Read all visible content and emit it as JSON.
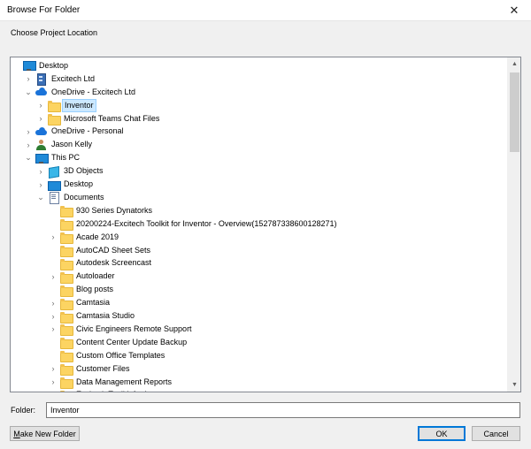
{
  "window": {
    "title": "Browse For Folder",
    "close_glyph": "✕"
  },
  "prompt": "Choose Project Location",
  "tree": {
    "items": [
      {
        "label": "Desktop",
        "level": 0,
        "chevron": "",
        "icon": "monitor-icon",
        "selected": false
      },
      {
        "label": "Excitech Ltd",
        "level": 1,
        "chevron": "›",
        "icon": "building-icon",
        "selected": false
      },
      {
        "label": "OneDrive - Excitech Ltd",
        "level": 1,
        "chevron": "⌄",
        "icon": "cloud-icon",
        "selected": false
      },
      {
        "label": "Inventor",
        "level": 2,
        "chevron": "›",
        "icon": "folder-icon",
        "selected": true
      },
      {
        "label": "Microsoft Teams Chat Files",
        "level": 2,
        "chevron": "›",
        "icon": "folder-icon",
        "selected": false
      },
      {
        "label": "OneDrive - Personal",
        "level": 1,
        "chevron": "›",
        "icon": "cloud-icon",
        "selected": false
      },
      {
        "label": "Jason Kelly",
        "level": 1,
        "chevron": "›",
        "icon": "person-icon",
        "selected": false
      },
      {
        "label": "This PC",
        "level": 1,
        "chevron": "⌄",
        "icon": "monitor-icon",
        "selected": false
      },
      {
        "label": "3D Objects",
        "level": 2,
        "chevron": "›",
        "icon": "cube-icon",
        "selected": false
      },
      {
        "label": "Desktop",
        "level": 2,
        "chevron": "›",
        "icon": "desktop-icon",
        "selected": false
      },
      {
        "label": "Documents",
        "level": 2,
        "chevron": "⌄",
        "icon": "document-icon",
        "selected": false
      },
      {
        "label": "930 Series Dynatorks",
        "level": 3,
        "chevron": "",
        "icon": "folder-icon",
        "selected": false
      },
      {
        "label": "20200224-Excitech Toolkit for Inventor - Overview(152787338600128271)",
        "level": 3,
        "chevron": "",
        "icon": "folder-icon",
        "selected": false
      },
      {
        "label": "Acade 2019",
        "level": 3,
        "chevron": "›",
        "icon": "folder-icon",
        "selected": false
      },
      {
        "label": "AutoCAD Sheet Sets",
        "level": 3,
        "chevron": "",
        "icon": "folder-icon",
        "selected": false
      },
      {
        "label": "Autodesk Screencast",
        "level": 3,
        "chevron": "",
        "icon": "folder-icon",
        "selected": false
      },
      {
        "label": "Autoloader",
        "level": 3,
        "chevron": "›",
        "icon": "folder-icon",
        "selected": false
      },
      {
        "label": "Blog posts",
        "level": 3,
        "chevron": "",
        "icon": "folder-icon",
        "selected": false
      },
      {
        "label": "Camtasia",
        "level": 3,
        "chevron": "›",
        "icon": "folder-icon",
        "selected": false
      },
      {
        "label": "Camtasia Studio",
        "level": 3,
        "chevron": "›",
        "icon": "folder-icon",
        "selected": false
      },
      {
        "label": "Civic Engineers Remote Support",
        "level": 3,
        "chevron": "›",
        "icon": "folder-icon",
        "selected": false
      },
      {
        "label": "Content Center Update Backup",
        "level": 3,
        "chevron": "",
        "icon": "folder-icon",
        "selected": false
      },
      {
        "label": "Custom Office Templates",
        "level": 3,
        "chevron": "",
        "icon": "folder-icon",
        "selected": false
      },
      {
        "label": "Customer Files",
        "level": 3,
        "chevron": "›",
        "icon": "folder-icon",
        "selected": false
      },
      {
        "label": "Data Management Reports",
        "level": 3,
        "chevron": "›",
        "icon": "folder-icon",
        "selected": false
      },
      {
        "label": "Excitech Toolkit for Inventor",
        "level": 3,
        "chevron": "",
        "icon": "folder-icon",
        "selected": false
      }
    ]
  },
  "folder_field": {
    "label": "Folder:",
    "value": "Inventor"
  },
  "buttons": {
    "make_new_folder": "Make New Folder",
    "make_new_folder_accel": "M",
    "make_new_folder_rest": "ake New Folder",
    "ok": "OK",
    "cancel": "Cancel"
  },
  "colors": {
    "selection": "#cce8ff",
    "selection_border": "#99d1ff",
    "accent": "#0078d7",
    "folder": "#fcd462"
  }
}
